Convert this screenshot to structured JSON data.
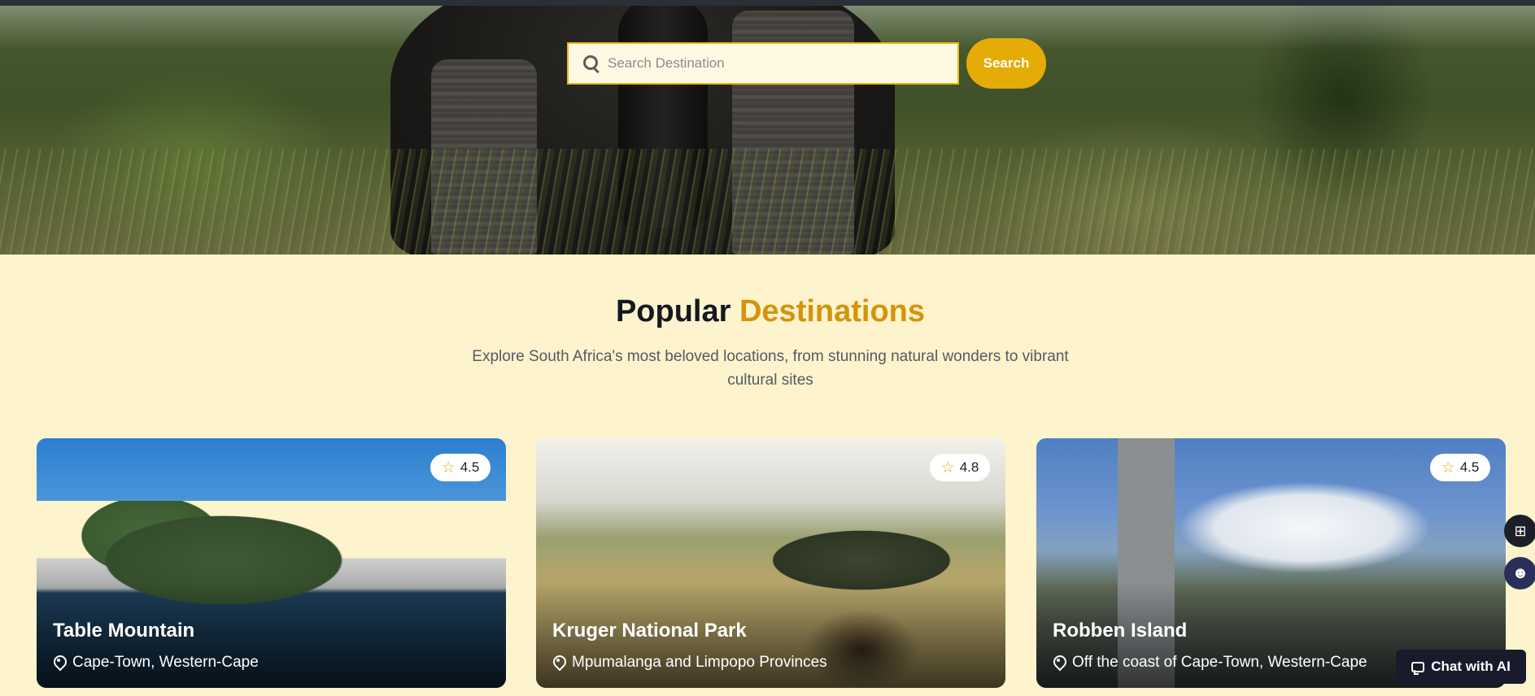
{
  "search": {
    "placeholder": "Search Destination",
    "button_label": "Search",
    "accent_color": "#e5ac07"
  },
  "section": {
    "title_main": "Popular",
    "title_accent": "Destinations",
    "subtitle": "Explore South Africa's most beloved locations, from stunning natural wonders to vibrant cultural sites"
  },
  "cards": [
    {
      "title": "Table Mountain",
      "location": "Cape-Town, Western-Cape",
      "rating": "4.5"
    },
    {
      "title": "Kruger National Park",
      "location": "Mpumalanga and Limpopo Provinces",
      "rating": "4.8"
    },
    {
      "title": "Robben Island",
      "location": "Off the coast of Cape-Town, Western-Cape",
      "rating": "4.5"
    }
  ],
  "floating": {
    "grid_icon": "grid-icon",
    "bot_icon": "bot-icon",
    "chat_label": "Chat with AI"
  }
}
